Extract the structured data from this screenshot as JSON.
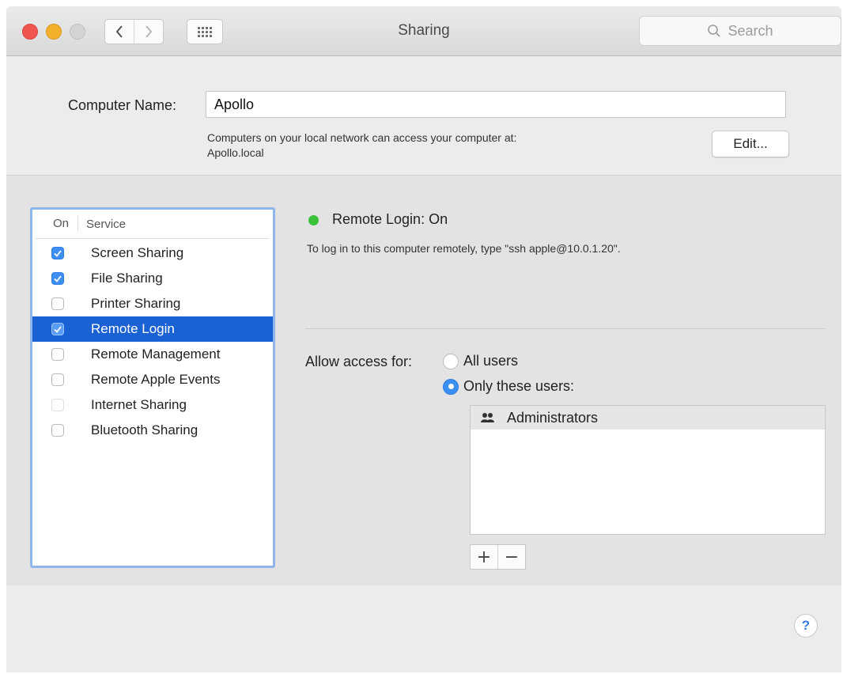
{
  "window": {
    "title": "Sharing",
    "back_glyph": "<",
    "forward_glyph": ">"
  },
  "search": {
    "placeholder": "Search",
    "icon": "search-icon"
  },
  "computer_name": {
    "label": "Computer Name:",
    "value": "Apollo",
    "description_line1": "Computers on your local network can access your computer at:",
    "description_line2": "Apollo.local",
    "edit_label": "Edit..."
  },
  "services": {
    "header_on": "On",
    "header_service": "Service",
    "items": [
      {
        "label": "Screen Sharing",
        "checked": true
      },
      {
        "label": "File Sharing",
        "checked": true
      },
      {
        "label": "Printer Sharing",
        "checked": false
      },
      {
        "label": "Remote Login",
        "checked": true,
        "selected": true
      },
      {
        "label": "Remote Management",
        "checked": false
      },
      {
        "label": "Remote Apple Events",
        "checked": false
      },
      {
        "label": "Internet Sharing",
        "checked": false,
        "disabled": true
      },
      {
        "label": "Bluetooth Sharing",
        "checked": false
      }
    ]
  },
  "detail": {
    "status": "Remote Login: On",
    "status_color": "#3cc13b",
    "description": "To log in to this computer remotely, type \"ssh apple@10.0.1.20\".",
    "allow_label": "Allow access for:",
    "option_all": "All users",
    "option_only": "Only these users:",
    "selected_option": "only",
    "users": [
      "Administrators"
    ],
    "add_label": "+",
    "remove_label": "−"
  },
  "help_label": "?",
  "colors": {
    "accent": "#3b8ef2",
    "selection": "#1a62d3"
  }
}
